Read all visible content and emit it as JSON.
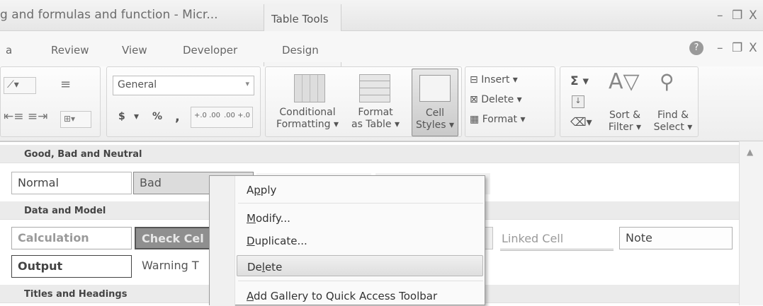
{
  "window": {
    "title": "g and formulas and function - Micr...",
    "context_tab": "Table Tools",
    "buttons": {
      "minimize": "–",
      "restore": "❐",
      "close": "X"
    },
    "ribbon_buttons": {
      "help": "?",
      "minimize": "–",
      "restore": "❐",
      "close": "X"
    }
  },
  "menu_tabs": [
    "a",
    "Review",
    "View",
    "Developer",
    "Design"
  ],
  "ribbon": {
    "number_format": "General",
    "currency": "$",
    "percent": "%",
    "comma": ",",
    "inc_decimal": "+.0 .00",
    "dec_decimal": ".00 +.0",
    "conditional_formatting": [
      "Conditional",
      "Formatting ▾"
    ],
    "format_as_table": [
      "Format",
      "as Table ▾"
    ],
    "cell_styles": [
      "Cell",
      "Styles ▾"
    ],
    "insert": "Insert ▾",
    "delete": "Delete ▾",
    "format": "Format ▾",
    "sigma": "Σ ▾",
    "sort_filter": [
      "Sort &",
      "Filter ▾"
    ],
    "find_select": [
      "Find &",
      "Select ▾"
    ]
  },
  "gallery": {
    "sections": [
      "Good, Bad and Neutral",
      "Data and Model",
      "Titles and Headings"
    ],
    "row1": [
      "Normal",
      "Bad"
    ],
    "row2": [
      "Calculation",
      "Check Cel",
      "Linked Cell",
      "Note"
    ],
    "row3": [
      "Output",
      "Warning T"
    ],
    "colors": {
      "bad_bg": "#dcdcdc",
      "check_bg": "#8f8f8f"
    }
  },
  "context_menu": {
    "items": [
      {
        "pre": "A",
        "u": "p",
        "post": "ply"
      },
      {
        "pre": "",
        "u": "M",
        "post": "odify..."
      },
      {
        "pre": "",
        "u": "D",
        "post": "uplicate..."
      },
      {
        "pre": "De",
        "u": "l",
        "post": "ete"
      },
      {
        "pre": "",
        "u": "A",
        "post": "dd Gallery to Quick Access Toolbar"
      }
    ]
  }
}
